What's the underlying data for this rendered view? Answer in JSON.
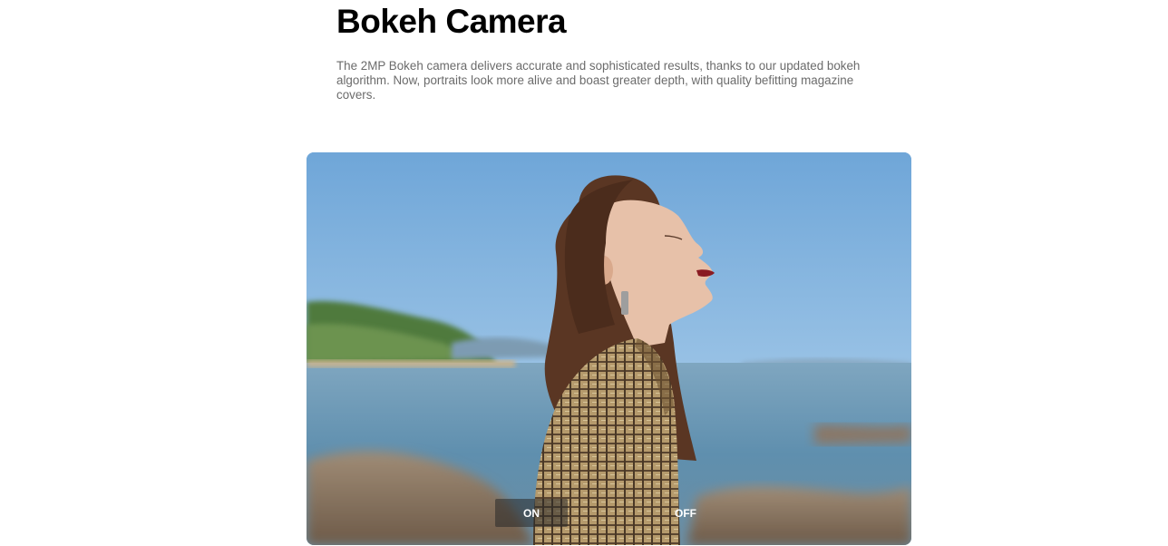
{
  "section": {
    "title": "Bokeh Camera",
    "description": "The 2MP Bokeh camera delivers accurate and sophisticated results, thanks to our updated bokeh algorithm. Now, portraits look more alive and boast greater depth, with quality befitting magazine covers."
  },
  "comparison": {
    "on_label": "ON",
    "off_label": "OFF",
    "active": "ON"
  },
  "colors": {
    "title": "#000000",
    "description": "#6b6b6b",
    "sky": "#7fb0dc",
    "sea": "#5f8fae"
  }
}
